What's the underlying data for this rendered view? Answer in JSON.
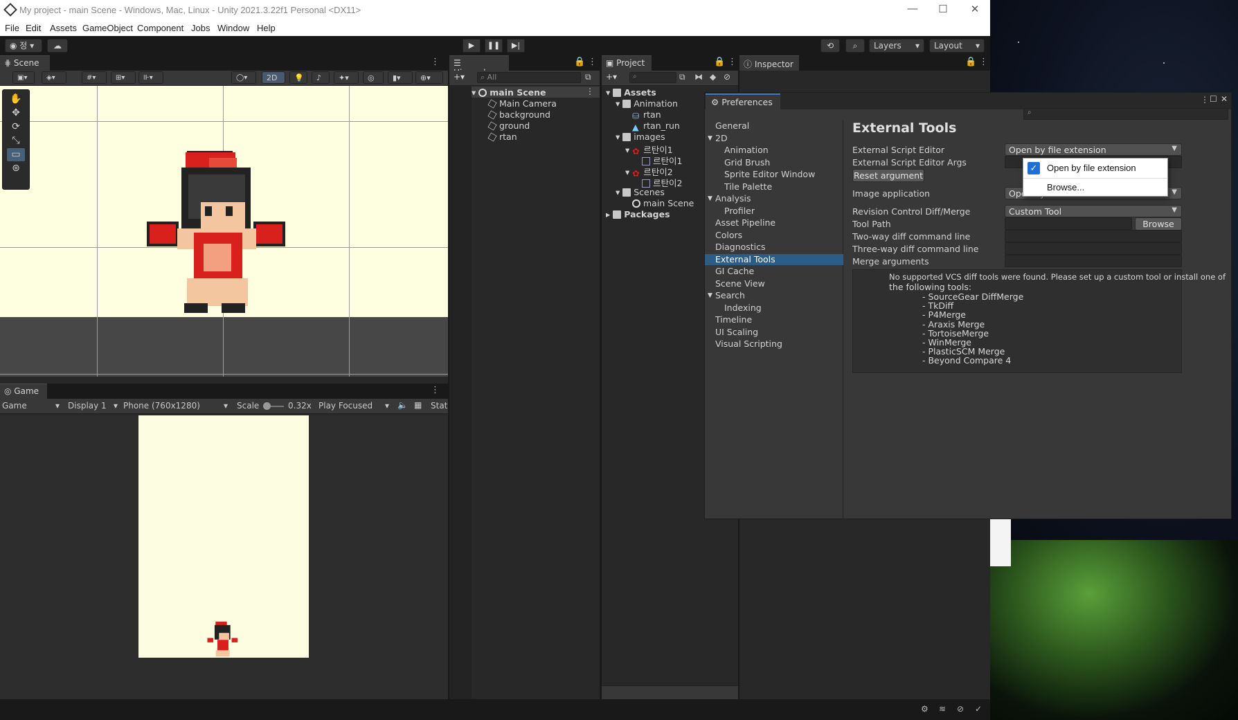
{
  "window": {
    "title": "My project - main Scene - Windows, Mac, Linux - Unity 2021.3.22f1 Personal <DX11>",
    "controls": [
      "—",
      "☐",
      "✕"
    ]
  },
  "menu": [
    "File",
    "Edit",
    "Assets",
    "GameObject",
    "Component",
    "Jobs",
    "Window",
    "Help"
  ],
  "toolbar": {
    "account_label": "정",
    "layers": "Layers",
    "layout": "Layout"
  },
  "scene": {
    "tab": "Scene",
    "mode_2d": "2D"
  },
  "game": {
    "tab": "Game",
    "view_select": "Game",
    "display": "Display 1",
    "resolution": "Phone (760x1280)",
    "scale_label": "Scale",
    "scale_value": "0.32x",
    "play_focused": "Play Focused",
    "stats": "Stat"
  },
  "hierarchy": {
    "tab": "Hierarchy",
    "search_placeholder": "All",
    "scene": "main Scene",
    "items": [
      "Main Camera",
      "background",
      "ground",
      "rtan"
    ]
  },
  "project": {
    "tab": "Project",
    "tree": {
      "assets": "Assets",
      "animation": "Animation",
      "rtan": "rtan",
      "rtan_run": "rtan_run",
      "images": "images",
      "img1": "르탄이1",
      "img1_sub": "르탄이1",
      "img2": "르탄이2",
      "img2_sub": "르탄이2",
      "scenes": "Scenes",
      "main_scene": "main Scene",
      "packages": "Packages"
    }
  },
  "inspector": {
    "tab": "Inspector"
  },
  "preferences": {
    "tab": "Preferences",
    "sidebar": [
      {
        "label": "General",
        "indent": 0,
        "arrow": ""
      },
      {
        "label": "2D",
        "indent": 0,
        "arrow": "▼"
      },
      {
        "label": "Animation",
        "indent": 1,
        "arrow": ""
      },
      {
        "label": "Grid Brush",
        "indent": 1,
        "arrow": ""
      },
      {
        "label": "Sprite Editor Window",
        "indent": 1,
        "arrow": ""
      },
      {
        "label": "Tile Palette",
        "indent": 1,
        "arrow": ""
      },
      {
        "label": "Analysis",
        "indent": 0,
        "arrow": "▼"
      },
      {
        "label": "Profiler",
        "indent": 1,
        "arrow": ""
      },
      {
        "label": "Asset Pipeline",
        "indent": 0,
        "arrow": ""
      },
      {
        "label": "Colors",
        "indent": 0,
        "arrow": ""
      },
      {
        "label": "Diagnostics",
        "indent": 0,
        "arrow": ""
      },
      {
        "label": "External Tools",
        "indent": 0,
        "arrow": "",
        "selected": true
      },
      {
        "label": "GI Cache",
        "indent": 0,
        "arrow": ""
      },
      {
        "label": "Scene View",
        "indent": 0,
        "arrow": ""
      },
      {
        "label": "Search",
        "indent": 0,
        "arrow": "▼"
      },
      {
        "label": "Indexing",
        "indent": 1,
        "arrow": ""
      },
      {
        "label": "Timeline",
        "indent": 0,
        "arrow": ""
      },
      {
        "label": "UI Scaling",
        "indent": 0,
        "arrow": ""
      },
      {
        "label": "Visual Scripting",
        "indent": 0,
        "arrow": ""
      }
    ],
    "heading": "External Tools",
    "script_editor_label": "External Script Editor",
    "script_editor_value": "Open by file extension",
    "script_args_label": "External Script Editor Args",
    "reset_button": "Reset argument",
    "image_app_label": "Image application",
    "image_app_value": "Open by file extension",
    "revision_label": "Revision Control Diff/Merge",
    "revision_value": "Custom Tool",
    "tool_path_label": "Tool Path",
    "tool_path_value": "",
    "browse_button": "Browse",
    "two_way_label": "Two-way diff command line",
    "three_way_label": "Three-way diff command line",
    "merge_label": "Merge arguments",
    "vcs_message_1": "No supported VCS diff tools were found. Please set up a custom tool or install one of",
    "vcs_message_2": "the following tools:",
    "vcs_tools": [
      "- SourceGear DiffMerge",
      "- TkDiff",
      "- P4Merge",
      "- Araxis Merge",
      "- TortoiseMerge",
      "- WinMerge",
      "- PlasticSCM Merge",
      "- Beyond Compare 4"
    ]
  },
  "popup": {
    "options": [
      "Open by file extension",
      "Browse..."
    ],
    "selected": "Open by file extension"
  },
  "colors": {
    "selection": "#2c5d87",
    "accent": "#3a78c9",
    "character_red": "#d8201c"
  }
}
